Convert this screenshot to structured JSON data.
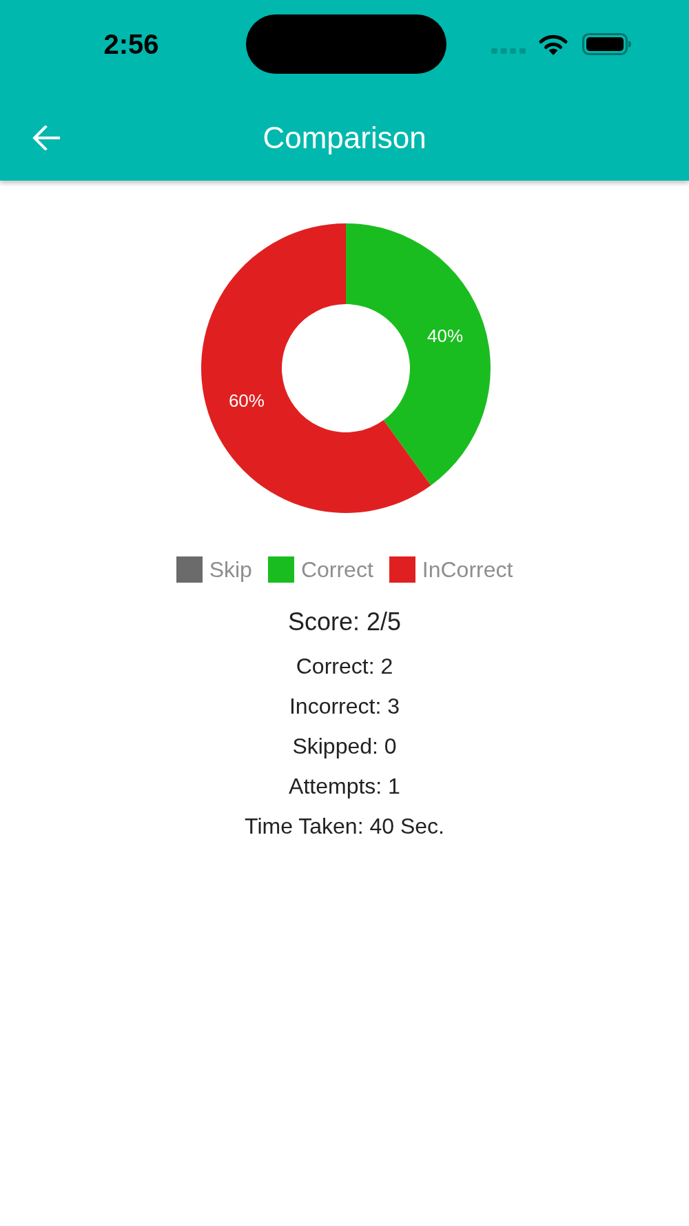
{
  "status_bar": {
    "time": "2:56"
  },
  "app_bar": {
    "title": "Comparison"
  },
  "chart": {
    "chart_data": {
      "type": "donut",
      "values": [
        0,
        40,
        60
      ],
      "value_labels": [
        null,
        "40%",
        "60%"
      ]
    }
  },
  "legend": [
    {
      "label": "Skip",
      "color": "#6b6b6b"
    },
    {
      "label": "Correct",
      "color": "#1abd1f"
    },
    {
      "label": "InCorrect",
      "color": "#e02020"
    }
  ],
  "score": "Score: 2/5",
  "stats": [
    "Correct: 2",
    "Incorrect: 3",
    "Skipped: 0",
    "Attempts: 1",
    "Time Taken: 40 Sec."
  ]
}
